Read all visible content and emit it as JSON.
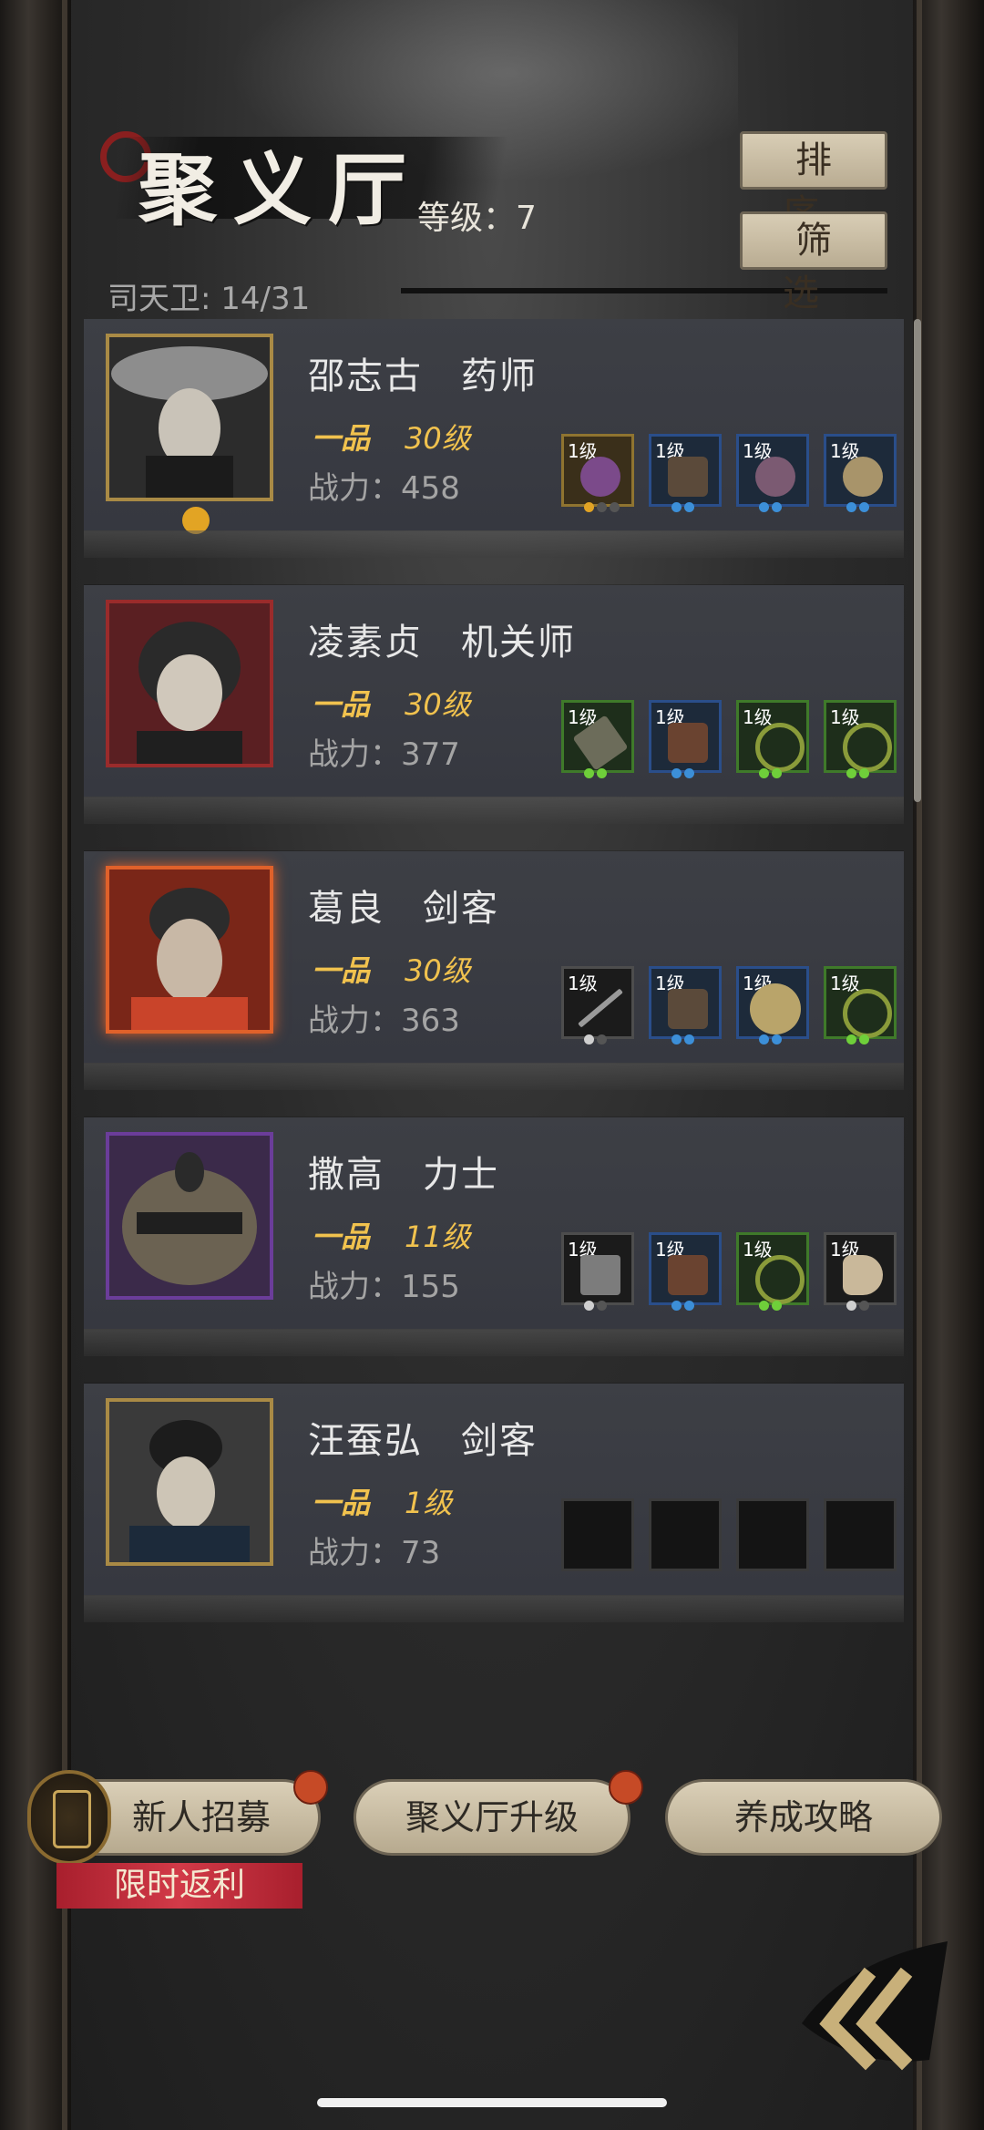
{
  "header": {
    "title": "聚义厅",
    "level_text": "等级：7",
    "guard_count": "司天卫: 14/31",
    "sort_label": "排序",
    "filter_label": "筛选"
  },
  "heroes": [
    {
      "name": "邵志古　药师",
      "rank": "一品",
      "level": "30级",
      "power": "战力：458",
      "equip": [
        "1级",
        "1级",
        "1级",
        "1级"
      ]
    },
    {
      "name": "凌素贞　机关师",
      "rank": "一品",
      "level": "30级",
      "power": "战力：377",
      "equip": [
        "1级",
        "1级",
        "1级",
        "1级"
      ]
    },
    {
      "name": "葛良　剑客",
      "rank": "一品",
      "level": "30级",
      "power": "战力：363",
      "equip": [
        "1级",
        "1级",
        "1级",
        "1级"
      ]
    },
    {
      "name": "撒高　力士",
      "rank": "一品",
      "level": "11级",
      "power": "战力：155",
      "equip": [
        "1级",
        "1级",
        "1级",
        "1级"
      ]
    },
    {
      "name": "汪蚕弘　剑客",
      "rank": "一品",
      "level": "1级",
      "power": "战力：73",
      "equip": []
    }
  ],
  "footer": {
    "recruit_label": "新人招募",
    "upgrade_label": "聚义厅升级",
    "guide_label": "养成攻略",
    "promo_label": "限时返利"
  },
  "colors": {
    "gold_text": "#f1c24e",
    "button_bg": "#d8cdb5",
    "red_dot": "#c64a26",
    "promo_bg": "#c02a39"
  },
  "icons": [
    "crane-decoration",
    "back-double-chevron-icon",
    "recruit-scroll-icon",
    "rank-badge-icon"
  ]
}
